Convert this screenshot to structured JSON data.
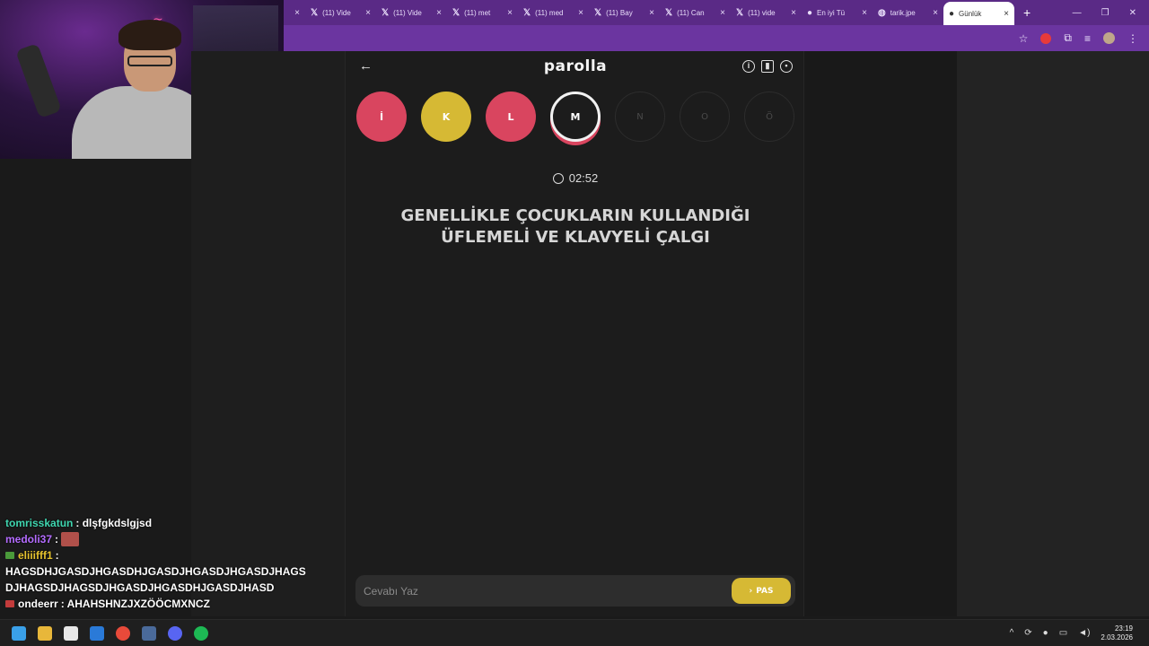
{
  "browser": {
    "tabs": [
      {
        "label": "(11) Vide",
        "icon": "x-logo-icon"
      },
      {
        "label": "(11) Vide",
        "icon": "x-logo-icon"
      },
      {
        "label": "(11) met",
        "icon": "x-logo-icon"
      },
      {
        "label": "(11) med",
        "icon": "x-logo-icon"
      },
      {
        "label": "(11) Bay",
        "icon": "x-logo-icon"
      },
      {
        "label": "(11) Can",
        "icon": "x-logo-icon"
      },
      {
        "label": "(11) vide",
        "icon": "x-logo-icon"
      },
      {
        "label": "En iyi Tü",
        "icon": "site-icon"
      },
      {
        "label": "tarik.jpe",
        "icon": "globe-icon"
      },
      {
        "label": "Günlük",
        "icon": "parolla-icon",
        "active": true
      }
    ]
  },
  "game": {
    "title": "parolla",
    "letters": [
      {
        "char": "İ",
        "state": "wrong"
      },
      {
        "char": "K",
        "state": "passed"
      },
      {
        "char": "L",
        "state": "wrong"
      },
      {
        "char": "M",
        "state": "current"
      },
      {
        "char": "N",
        "state": "pending"
      },
      {
        "char": "O",
        "state": "pending"
      },
      {
        "char": "Ö",
        "state": "pending"
      }
    ],
    "timer": "02:52",
    "question": "GENELLİKLE ÇOCUKLARIN KULLANDIĞI ÜFLEMELİ VE KLAVYELİ ÇALGI",
    "answer_placeholder": "Cevabı Yaz",
    "pass_label": "PAS"
  },
  "chat": [
    {
      "user": "tomrisskatun",
      "color": "#3fd6b0",
      "text": "dlşfgkdslgjsd"
    },
    {
      "user": "medoli37",
      "color": "#b46cff",
      "text": "",
      "emote": true
    },
    {
      "user": "eliiifff1",
      "color": "#e6c22e",
      "text": "HAGSDHJGASDJHGASDHJGASDJHGASDJHGASDJHAGS DJHAGSDJHAGSDJHGASDJHGASDHJGASDJHASD",
      "badge": "green"
    },
    {
      "user": "ondeerr",
      "color": "#ffffff",
      "text": "AHAHSHNZJXZÖÖCMXNCZ",
      "badge": "red"
    }
  ],
  "taskbar": {
    "time": "23:19",
    "date": "2.03.2026"
  },
  "colors": {
    "wrong": "#d9455f",
    "passed": "#d6b934",
    "browser_frame": "#6b35a0"
  }
}
